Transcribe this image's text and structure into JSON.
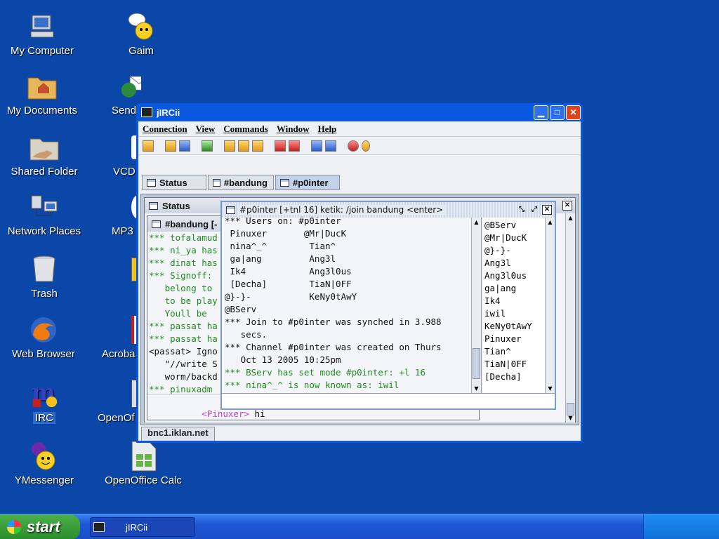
{
  "desktop": {
    "icons": [
      {
        "label": "My Computer"
      },
      {
        "label": "My Documents"
      },
      {
        "label": "Shared Folder"
      },
      {
        "label": "Network Places"
      },
      {
        "label": "Trash"
      },
      {
        "label": "Web Browser"
      },
      {
        "label": "IRC"
      },
      {
        "label": "YMessenger"
      },
      {
        "label": "Gaim"
      },
      {
        "label": "Send"
      },
      {
        "label": "VCD"
      },
      {
        "label": "MP3"
      },
      {
        "label": "Acroba"
      },
      {
        "label": "OpenOf"
      },
      {
        "label": "OpenOffice Calc"
      }
    ]
  },
  "window": {
    "title": "jIRCii",
    "menu": [
      "Connection",
      "View",
      "Commands",
      "Window",
      "Help"
    ],
    "tabs": [
      "Status",
      "#bandung",
      "#p0inter"
    ],
    "server_tab": "bnc1.iklan.net"
  },
  "status_window": {
    "title": "Status"
  },
  "bandung_window": {
    "title": "#bandung [-",
    "lines": [
      {
        "text": "*** tofalamud",
        "color": "#1f8a1f"
      },
      {
        "text": "*** ni_ya has",
        "color": "#1f8a1f"
      },
      {
        "text": "*** dinat has",
        "color": "#1f8a1f"
      },
      {
        "text": "*** Signoff: ",
        "color": "#1f8a1f"
      },
      {
        "text": "   belong to",
        "color": "#1f8a1f"
      },
      {
        "text": "   to be play",
        "color": "#1f8a1f"
      },
      {
        "text": "   Youll be",
        "color": "#1f8a1f"
      },
      {
        "text": "*** passat ha",
        "color": "#1f8a1f"
      },
      {
        "text": "*** passat ha",
        "color": "#1f8a1f"
      },
      {
        "text": "<passat> Igno",
        "color": "#111111"
      },
      {
        "text": "   \"//write S",
        "color": "#111111"
      },
      {
        "text": "   worm/backd",
        "color": "#111111"
      },
      {
        "text": "*** pinuxadm",
        "color": "#1f8a1f"
      }
    ],
    "input_nick": "<Pinuxer>",
    "input_text": "hi"
  },
  "pointer_window": {
    "title": "#p0inter [+tnl 16]  ketik: /join bandung <enter>",
    "lines": [
      {
        "text": "*** Users on: #p0inter",
        "color": "#111111"
      },
      {
        "text": " Pinuxer       @Mr|DucK",
        "color": "#111111"
      },
      {
        "text": " nina^_^        Tian^",
        "color": "#111111"
      },
      {
        "text": " ga|ang         Ang3l",
        "color": "#111111"
      },
      {
        "text": " Ik4            Ang3l0us",
        "color": "#111111"
      },
      {
        "text": " [Decha]        TiaN|0FF",
        "color": "#111111"
      },
      {
        "text": "@}-}-           KeNy0tAwY",
        "color": "#111111"
      },
      {
        "text": "@BServ",
        "color": "#111111"
      },
      {
        "text": "*** Join to #p0inter was synched in 3.988",
        "color": "#111111"
      },
      {
        "text": "   secs.",
        "color": "#111111"
      },
      {
        "text": "*** Channel #p0inter was created on Thurs",
        "color": "#111111"
      },
      {
        "text": "   Oct 13 2005 10:25pm",
        "color": "#111111"
      },
      {
        "text": "*** BServ has set mode #p0inter: +l 16",
        "color": "#1f8a1f"
      },
      {
        "text": "*** nina^_^ is now known as: iwil",
        "color": "#1f8a1f"
      }
    ],
    "nicklist": [
      "@BServ",
      "@Mr|DucK",
      "@}-}-",
      "Ang3l",
      "Ang3l0us",
      "ga|ang",
      "Ik4",
      "iwil",
      "KeNy0tAwY",
      "Pinuxer",
      "Tian^",
      "TiaN|0FF",
      "[Decha]"
    ]
  },
  "taskbar": {
    "start_label": "start",
    "task_label": "jIRCii"
  }
}
